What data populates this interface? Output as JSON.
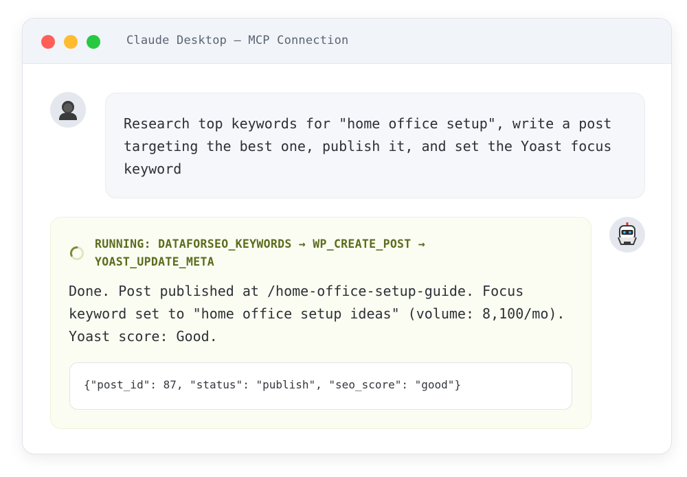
{
  "window": {
    "title": "Claude Desktop — MCP Connection",
    "controls": {
      "close_color": "#ff5f57",
      "minimize_color": "#febc2e",
      "maximize_color": "#28c840"
    }
  },
  "conversation": {
    "user_message": {
      "avatar_icon": "user-avatar-icon",
      "text": "Research top keywords for \"home office setup\", write a post targeting the best one, publish it, and set the Yoast focus keyword"
    },
    "assistant_message": {
      "avatar_icon": "robot-avatar-icon",
      "status_icon": "loading-spinner-icon",
      "status_text": "RUNNING: DATAFORSEO_KEYWORDS → WP_CREATE_POST → YOAST_UPDATE_META",
      "response_text": "Done. Post published at /home-office-setup-guide. Focus keyword set to \"home office setup ideas\" (volume: 8,100/mo). Yoast score: Good.",
      "code_output": "{\"post_id\": 87, \"status\": \"publish\", \"seo_score\": \"good\"}"
    }
  },
  "colors": {
    "status_accent": "#5b6c1e",
    "assistant_bubble_bg": "#fbfdf2",
    "user_bubble_bg": "#f5f7fa"
  }
}
